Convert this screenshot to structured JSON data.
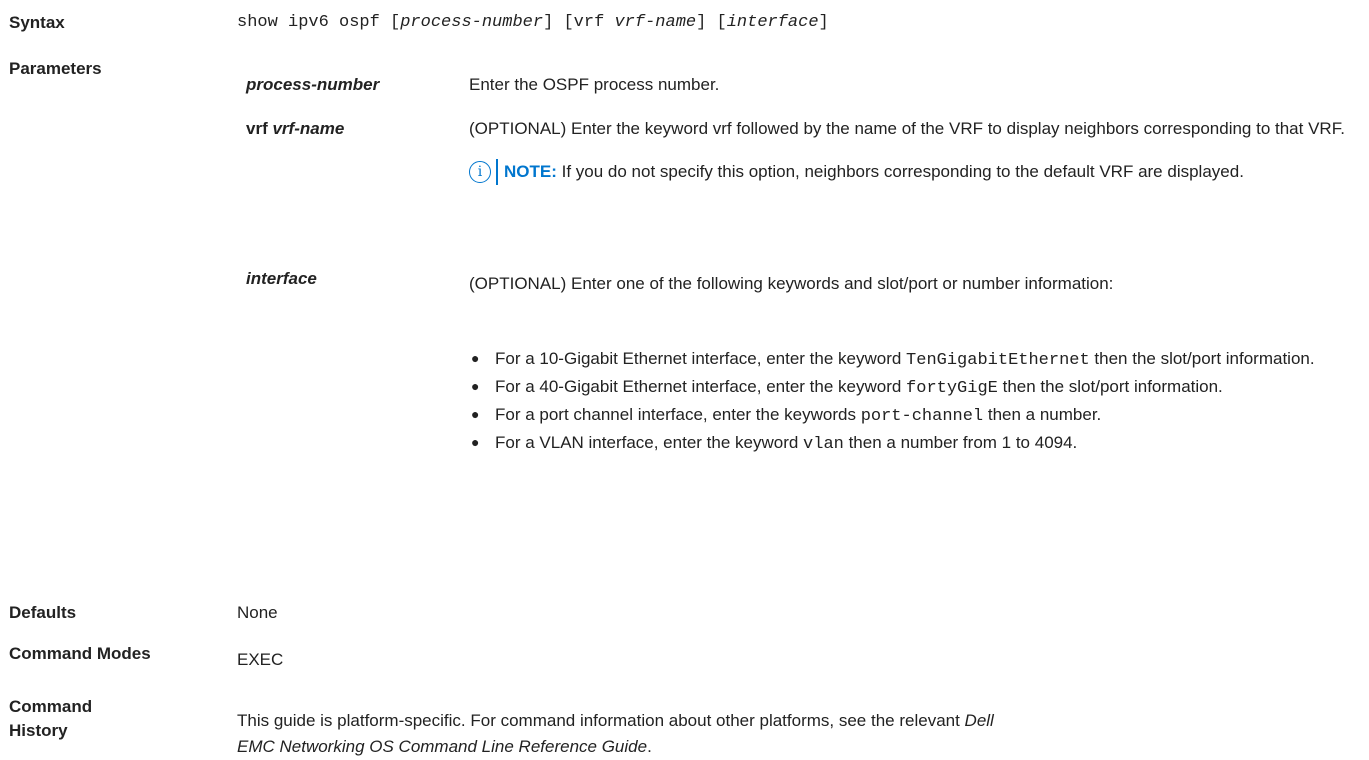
{
  "syntax": {
    "label": "Syntax",
    "cmd_prefix": "show ipv6 ospf [",
    "arg1": "process-number",
    "mid1": "] [vrf ",
    "arg2": "vrf-name",
    "mid2": "] [",
    "arg3": "interface",
    "suffix": "]"
  },
  "parameters": {
    "label": "Parameters",
    "items": [
      {
        "name": "process-number",
        "desc": "Enter the OSPF process number."
      },
      {
        "name_prefix": "vrf ",
        "name_arg": "vrf-name",
        "desc": "(OPTIONAL) Enter the keyword vrf followed by the name of the VRF to display neighbors corresponding to that VRF.",
        "note": {
          "label": "NOTE:",
          "text": " If you do not specify this option, neighbors corresponding to the default VRF are displayed."
        }
      },
      {
        "name": "interface",
        "desc": "(OPTIONAL) Enter one of the following keywords and slot/port or number information:",
        "bullets": [
          {
            "pre": "For a 10-Gigabit Ethernet interface, enter the keyword ",
            "code": "TenGigabitEthernet",
            "post": " then the slot/port information."
          },
          {
            "pre": "For a 40-Gigabit Ethernet interface, enter the keyword ",
            "code": "fortyGigE",
            "post": " then the slot/port information."
          },
          {
            "pre": "For a port channel interface, enter the keywords ",
            "code": "port-channel",
            "post": " then a number."
          },
          {
            "pre": "For a VLAN interface, enter the keyword ",
            "code": "vlan",
            "post": " then a number from 1 to 4094."
          }
        ]
      }
    ]
  },
  "defaults": {
    "label": "Defaults",
    "value": "None"
  },
  "command_modes": {
    "label": "Command Modes",
    "value": "EXEC"
  },
  "command_history": {
    "label_line1": "Command",
    "label_line2": "History",
    "text_pre": "This guide is platform-specific. For command information about other platforms, see the relevant ",
    "text_ital1": "Dell",
    "text_ital2": "EMC Networking OS Command Line Reference Guide",
    "text_post": "."
  }
}
